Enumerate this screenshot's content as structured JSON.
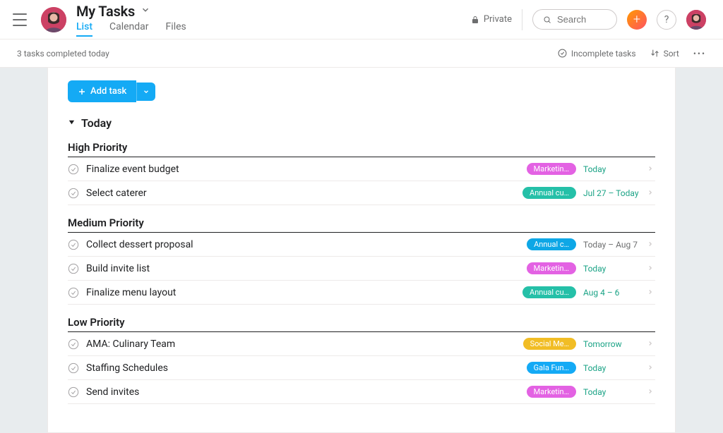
{
  "header": {
    "title": "My Tasks",
    "tabs": [
      {
        "label": "List",
        "active": true
      },
      {
        "label": "Calendar",
        "active": false
      },
      {
        "label": "Files",
        "active": false
      }
    ],
    "private_label": "Private",
    "search_placeholder": "Search"
  },
  "subbar": {
    "status_text": "3 tasks completed today",
    "filter_label": "Incomplete tasks",
    "sort_label": "Sort"
  },
  "toolbar": {
    "add_task_label": "Add task"
  },
  "colors": {
    "pink": "#e362e3",
    "teal": "#25c0a8",
    "blue2": "#0ea7e6",
    "yellow": "#f1bd25",
    "cyan": "#14aaf5",
    "today_green": "#1ba386",
    "grey": "#6d6e6f"
  },
  "sections": [
    {
      "title": "Today",
      "groups": [
        {
          "title": "High Priority",
          "tasks": [
            {
              "name": "Finalize event budget",
              "tag": "Marketin…",
              "tag_color": "pink",
              "date": "Today",
              "date_color": "today_green"
            },
            {
              "name": "Select caterer",
              "tag": "Annual cu…",
              "tag_color": "teal",
              "date": "Jul 27 – Today",
              "date_color": "today_green"
            }
          ]
        },
        {
          "title": "Medium Priority",
          "tasks": [
            {
              "name": "Collect dessert proposal",
              "tag": "Annual c…",
              "tag_color": "blue2",
              "date": "Today – Aug 7",
              "date_color": "grey"
            },
            {
              "name": "Build invite list",
              "tag": "Marketin…",
              "tag_color": "pink",
              "date": "Today",
              "date_color": "today_green"
            },
            {
              "name": "Finalize menu layout",
              "tag": "Annual cu…",
              "tag_color": "teal",
              "date": "Aug 4 – 6",
              "date_color": "today_green"
            }
          ]
        },
        {
          "title": "Low Priority",
          "tasks": [
            {
              "name": "AMA: Culinary Team",
              "tag": "Social Me…",
              "tag_color": "yellow",
              "date": "Tomorrow",
              "date_color": "today_green"
            },
            {
              "name": "Staffing Schedules",
              "tag": "Gala Fun…",
              "tag_color": "cyan",
              "date": "Today",
              "date_color": "today_green"
            },
            {
              "name": "Send invites",
              "tag": "Marketin…",
              "tag_color": "pink",
              "date": "Today",
              "date_color": "today_green"
            }
          ]
        }
      ]
    }
  ]
}
